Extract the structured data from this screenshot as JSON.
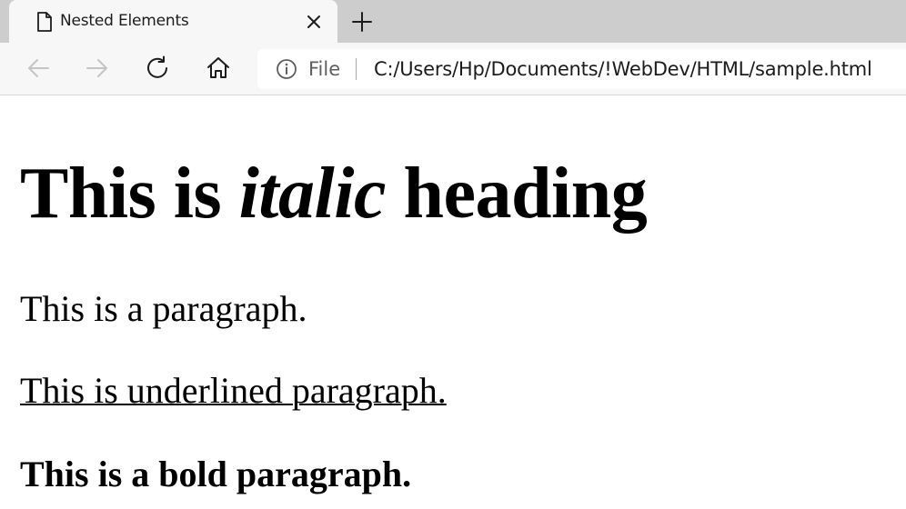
{
  "browser": {
    "tab": {
      "title": "Nested Elements",
      "icon": "document-icon",
      "close_icon": "close-icon"
    },
    "new_tab_icon": "plus-icon",
    "nav": {
      "back_icon": "arrow-left-icon",
      "forward_icon": "arrow-right-icon",
      "refresh_icon": "refresh-icon",
      "home_icon": "home-icon"
    },
    "address_bar": {
      "info_icon": "info-icon",
      "scheme_label": "File",
      "url": "C:/Users/Hp/Documents/!WebDev/HTML/sample.html"
    }
  },
  "page": {
    "heading": {
      "before": "This is ",
      "italic": "italic",
      "after": " heading"
    },
    "paragraph": "This is a paragraph.",
    "underlined_paragraph": "This is underlined paragraph.",
    "bold_paragraph": "This is a bold paragraph."
  }
}
